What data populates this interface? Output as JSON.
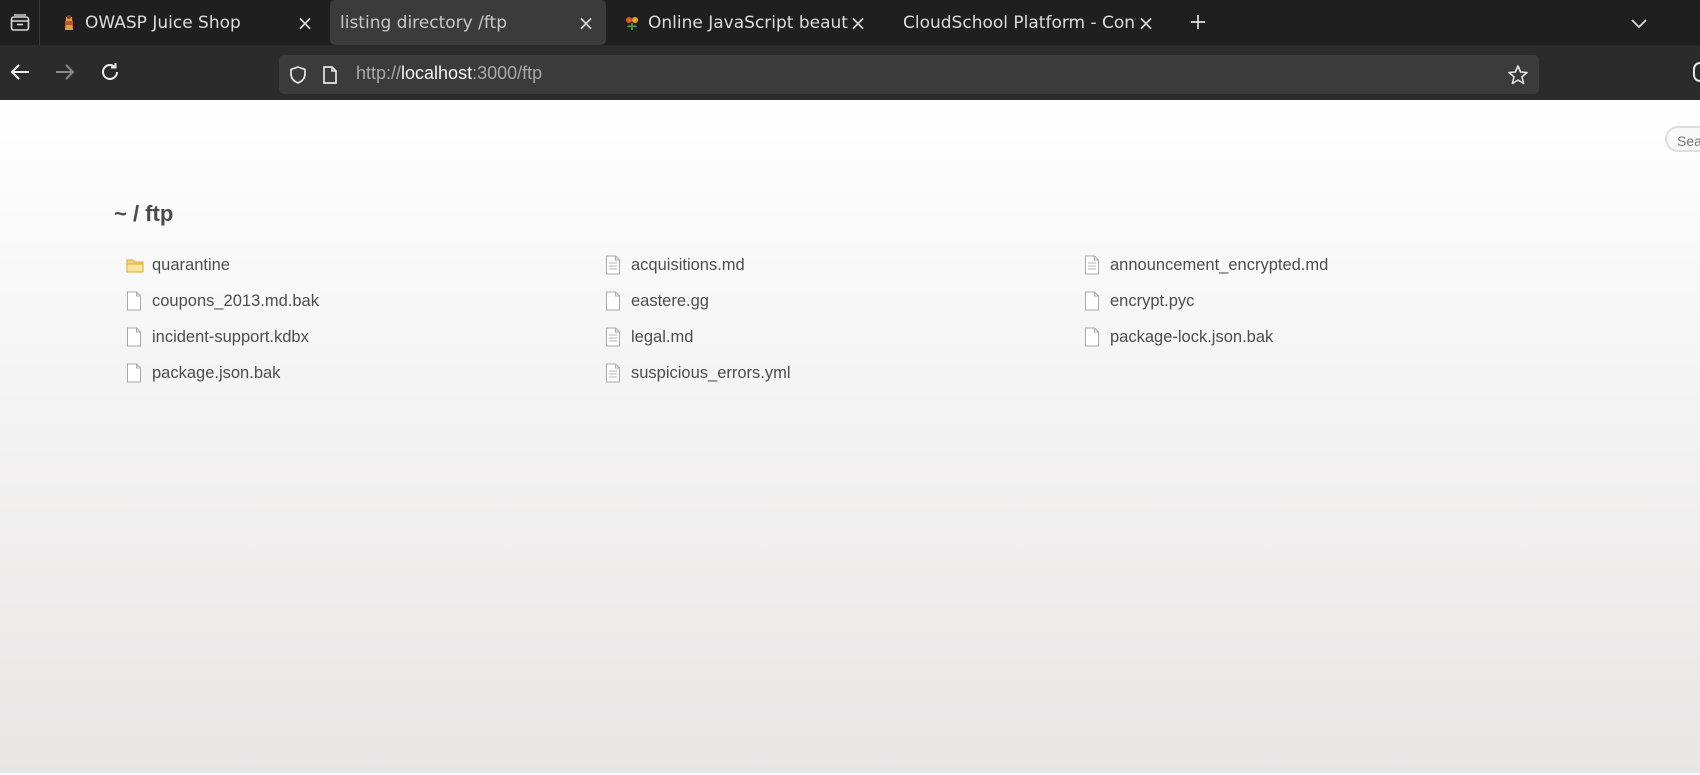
{
  "browser": {
    "tabs": [
      {
        "label": "OWASP Juice Shop",
        "favicon": "juice-shop-favicon",
        "active": false
      },
      {
        "label": "listing directory /ftp",
        "favicon": "",
        "active": true
      },
      {
        "label": "Online JavaScript beautifier",
        "favicon": "js-beautifier-favicon",
        "active": false
      },
      {
        "label": "CloudSchool Platform - Continue",
        "favicon": "",
        "active": false
      }
    ],
    "url": {
      "scheme": "http://",
      "host": "localhost",
      "rest": ":3000/ftp"
    },
    "icons": {
      "tab_tray": "tab-tray-icon",
      "back": "arrow-left-icon",
      "forward": "arrow-right-icon",
      "reload": "reload-icon",
      "shield": "shield-icon",
      "page": "page-icon",
      "bookmark": "star-icon",
      "new_tab": "plus-icon",
      "list_tabs": "chevron-down-icon"
    },
    "colors": {
      "tabstrip": "#1f1f1f",
      "toolbar": "#2b2b2b",
      "urlbar": "#3b3b3b"
    }
  },
  "page": {
    "search_placeholder": "Search",
    "breadcrumb": "~ / ftp",
    "files": [
      {
        "name": "quarantine",
        "type": "folder"
      },
      {
        "name": "acquisitions.md",
        "type": "text"
      },
      {
        "name": "announcement_encrypted.md",
        "type": "text"
      },
      {
        "name": "coupons_2013.md.bak",
        "type": "blank"
      },
      {
        "name": "eastere.gg",
        "type": "blank"
      },
      {
        "name": "encrypt.pyc",
        "type": "blank"
      },
      {
        "name": "incident-support.kdbx",
        "type": "blank"
      },
      {
        "name": "legal.md",
        "type": "text"
      },
      {
        "name": "package-lock.json.bak",
        "type": "blank"
      },
      {
        "name": "package.json.bak",
        "type": "blank"
      },
      {
        "name": "suspicious_errors.yml",
        "type": "text"
      }
    ]
  }
}
